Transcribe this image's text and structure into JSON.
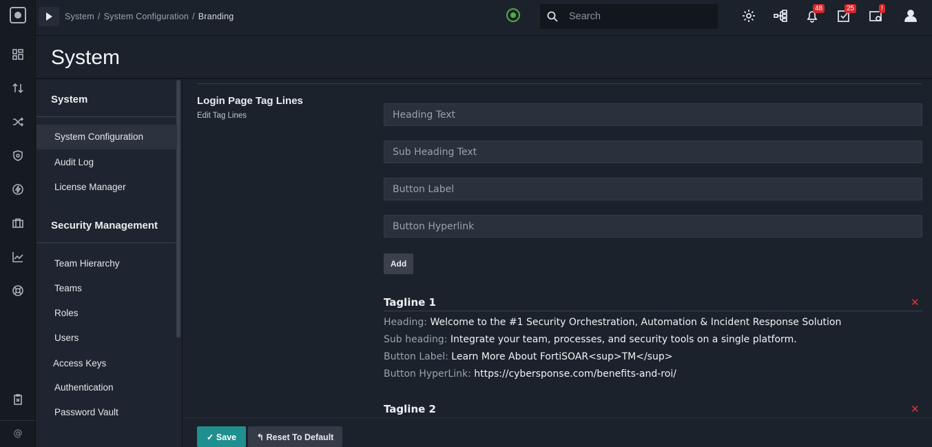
{
  "topbar": {
    "breadcrumb": [
      "System",
      "System Configuration",
      "Branding"
    ],
    "breadcrumb_sep": "/",
    "search_placeholder": "Search",
    "notifications_count": "48",
    "tasks_count": "25",
    "system_alert": "!"
  },
  "page": {
    "title": "System"
  },
  "sidebar": {
    "sections": [
      {
        "title": "System",
        "items": [
          "System Configuration",
          "Audit Log",
          "License Manager"
        ]
      },
      {
        "title": "Security Management",
        "items": [
          "Team Hierarchy",
          "Teams",
          "Roles",
          "Users",
          "Access Keys",
          "Authentication",
          "Password Vault"
        ]
      }
    ],
    "active_item": "System Configuration"
  },
  "section": {
    "title": "Login Page Tag Lines",
    "subtitle": "Edit Tag Lines",
    "fields": {
      "heading_placeholder": "Heading Text",
      "subheading_placeholder": "Sub Heading Text",
      "button_label_placeholder": "Button Label",
      "button_hyperlink_placeholder": "Button Hyperlink"
    },
    "add_label": "Add"
  },
  "taglines": [
    {
      "title": "Tagline 1",
      "heading_key": "Heading:",
      "heading": "Welcome to the #1 Security Orchestration, Automation & Incident Response Solution",
      "subheading_key": "Sub heading:",
      "subheading": "Integrate your team, processes, and security tools on a single platform.",
      "button_label_key": "Button Label:",
      "button_label": "Learn More About FortiSOAR<sup>TM</sup>",
      "button_link_key": "Button HyperLink:",
      "button_link": "https://cybersponse.com/benefits-and-roi/"
    },
    {
      "title": "Tagline 2"
    }
  ],
  "footer": {
    "save_label": "Save",
    "reset_label": "Reset To Default"
  },
  "rail": {
    "footer_symbol": "@"
  },
  "colors": {
    "accent": "#1f8f8f",
    "badge": "#d9262b",
    "remove": "#e2343b",
    "status_ok": "#4caf3f"
  }
}
